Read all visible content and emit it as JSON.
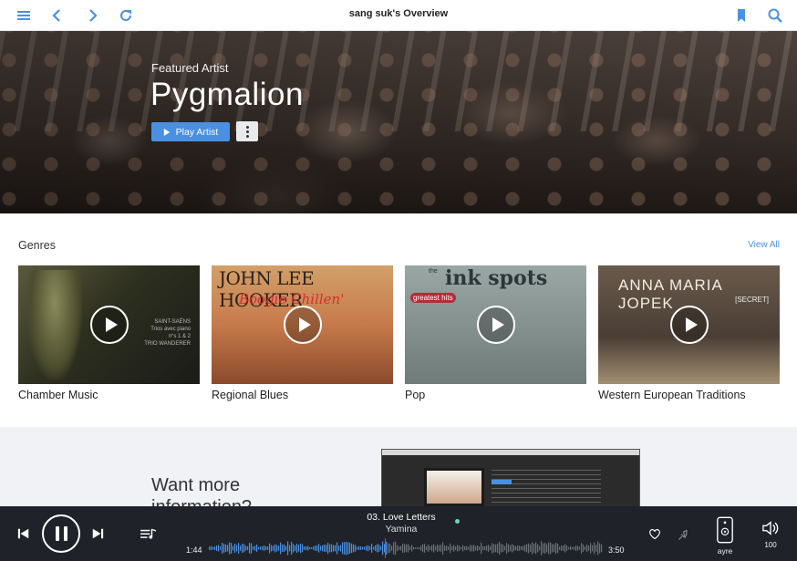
{
  "topbar": {
    "title": "sang suk's Overview",
    "icons": [
      "menu-icon",
      "back-icon",
      "forward-icon",
      "refresh-icon",
      "bookmark-icon",
      "search-icon"
    ],
    "accent": "#4a90e2"
  },
  "hero": {
    "subtitle": "Featured Artist",
    "title": "Pygmalion",
    "play_label": "Play Artist"
  },
  "genres": {
    "heading": "Genres",
    "view_all": "View All",
    "items": [
      {
        "label": "Chamber Music",
        "art_text": "SAINT-SAËNS\nTrios avec piano\nn°s 1 & 2\nTRIO WANDERER"
      },
      {
        "label": "Regional Blues",
        "art_text": "JOHN LEE HOOKER",
        "art_text2": "Boogie Chillen'"
      },
      {
        "label": "Pop",
        "art_text": "ink spots",
        "art_text0": "the",
        "art_text2": "greatest hits"
      },
      {
        "label": "Western European Traditions",
        "art_text": "ANNA MARIA JOPEK",
        "art_text2": "[SECRET]"
      }
    ]
  },
  "info": {
    "line1": "Want more",
    "line2": "information?"
  },
  "player": {
    "track": "03. Love Letters",
    "artist": "Yamina",
    "elapsed": "1:44",
    "duration": "3:50",
    "progress": 0.452,
    "output_device": "ayre",
    "volume": "100",
    "accent_wave": "#4a90e2",
    "playhead_color": "#e23b3b"
  }
}
